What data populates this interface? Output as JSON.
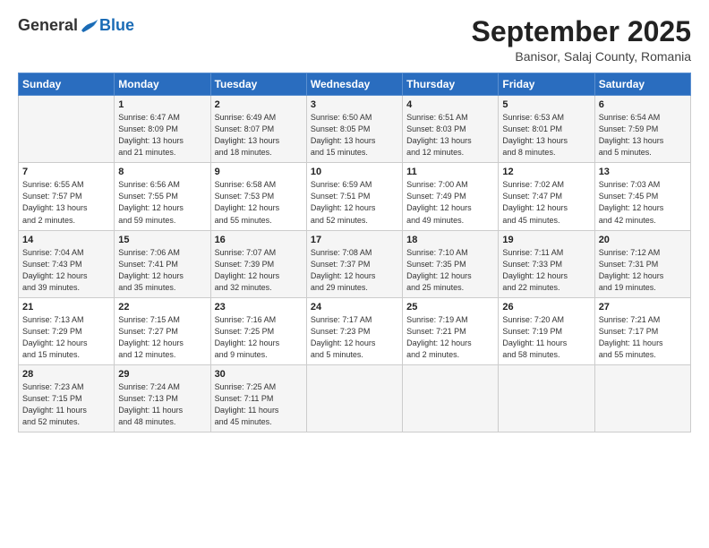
{
  "logo": {
    "general": "General",
    "blue": "Blue"
  },
  "title": "September 2025",
  "subtitle": "Banisor, Salaj County, Romania",
  "days_header": [
    "Sunday",
    "Monday",
    "Tuesday",
    "Wednesday",
    "Thursday",
    "Friday",
    "Saturday"
  ],
  "weeks": [
    [
      {
        "num": "",
        "info": ""
      },
      {
        "num": "1",
        "info": "Sunrise: 6:47 AM\nSunset: 8:09 PM\nDaylight: 13 hours\nand 21 minutes."
      },
      {
        "num": "2",
        "info": "Sunrise: 6:49 AM\nSunset: 8:07 PM\nDaylight: 13 hours\nand 18 minutes."
      },
      {
        "num": "3",
        "info": "Sunrise: 6:50 AM\nSunset: 8:05 PM\nDaylight: 13 hours\nand 15 minutes."
      },
      {
        "num": "4",
        "info": "Sunrise: 6:51 AM\nSunset: 8:03 PM\nDaylight: 13 hours\nand 12 minutes."
      },
      {
        "num": "5",
        "info": "Sunrise: 6:53 AM\nSunset: 8:01 PM\nDaylight: 13 hours\nand 8 minutes."
      },
      {
        "num": "6",
        "info": "Sunrise: 6:54 AM\nSunset: 7:59 PM\nDaylight: 13 hours\nand 5 minutes."
      }
    ],
    [
      {
        "num": "7",
        "info": "Sunrise: 6:55 AM\nSunset: 7:57 PM\nDaylight: 13 hours\nand 2 minutes."
      },
      {
        "num": "8",
        "info": "Sunrise: 6:56 AM\nSunset: 7:55 PM\nDaylight: 12 hours\nand 59 minutes."
      },
      {
        "num": "9",
        "info": "Sunrise: 6:58 AM\nSunset: 7:53 PM\nDaylight: 12 hours\nand 55 minutes."
      },
      {
        "num": "10",
        "info": "Sunrise: 6:59 AM\nSunset: 7:51 PM\nDaylight: 12 hours\nand 52 minutes."
      },
      {
        "num": "11",
        "info": "Sunrise: 7:00 AM\nSunset: 7:49 PM\nDaylight: 12 hours\nand 49 minutes."
      },
      {
        "num": "12",
        "info": "Sunrise: 7:02 AM\nSunset: 7:47 PM\nDaylight: 12 hours\nand 45 minutes."
      },
      {
        "num": "13",
        "info": "Sunrise: 7:03 AM\nSunset: 7:45 PM\nDaylight: 12 hours\nand 42 minutes."
      }
    ],
    [
      {
        "num": "14",
        "info": "Sunrise: 7:04 AM\nSunset: 7:43 PM\nDaylight: 12 hours\nand 39 minutes."
      },
      {
        "num": "15",
        "info": "Sunrise: 7:06 AM\nSunset: 7:41 PM\nDaylight: 12 hours\nand 35 minutes."
      },
      {
        "num": "16",
        "info": "Sunrise: 7:07 AM\nSunset: 7:39 PM\nDaylight: 12 hours\nand 32 minutes."
      },
      {
        "num": "17",
        "info": "Sunrise: 7:08 AM\nSunset: 7:37 PM\nDaylight: 12 hours\nand 29 minutes."
      },
      {
        "num": "18",
        "info": "Sunrise: 7:10 AM\nSunset: 7:35 PM\nDaylight: 12 hours\nand 25 minutes."
      },
      {
        "num": "19",
        "info": "Sunrise: 7:11 AM\nSunset: 7:33 PM\nDaylight: 12 hours\nand 22 minutes."
      },
      {
        "num": "20",
        "info": "Sunrise: 7:12 AM\nSunset: 7:31 PM\nDaylight: 12 hours\nand 19 minutes."
      }
    ],
    [
      {
        "num": "21",
        "info": "Sunrise: 7:13 AM\nSunset: 7:29 PM\nDaylight: 12 hours\nand 15 minutes."
      },
      {
        "num": "22",
        "info": "Sunrise: 7:15 AM\nSunset: 7:27 PM\nDaylight: 12 hours\nand 12 minutes."
      },
      {
        "num": "23",
        "info": "Sunrise: 7:16 AM\nSunset: 7:25 PM\nDaylight: 12 hours\nand 9 minutes."
      },
      {
        "num": "24",
        "info": "Sunrise: 7:17 AM\nSunset: 7:23 PM\nDaylight: 12 hours\nand 5 minutes."
      },
      {
        "num": "25",
        "info": "Sunrise: 7:19 AM\nSunset: 7:21 PM\nDaylight: 12 hours\nand 2 minutes."
      },
      {
        "num": "26",
        "info": "Sunrise: 7:20 AM\nSunset: 7:19 PM\nDaylight: 11 hours\nand 58 minutes."
      },
      {
        "num": "27",
        "info": "Sunrise: 7:21 AM\nSunset: 7:17 PM\nDaylight: 11 hours\nand 55 minutes."
      }
    ],
    [
      {
        "num": "28",
        "info": "Sunrise: 7:23 AM\nSunset: 7:15 PM\nDaylight: 11 hours\nand 52 minutes."
      },
      {
        "num": "29",
        "info": "Sunrise: 7:24 AM\nSunset: 7:13 PM\nDaylight: 11 hours\nand 48 minutes."
      },
      {
        "num": "30",
        "info": "Sunrise: 7:25 AM\nSunset: 7:11 PM\nDaylight: 11 hours\nand 45 minutes."
      },
      {
        "num": "",
        "info": ""
      },
      {
        "num": "",
        "info": ""
      },
      {
        "num": "",
        "info": ""
      },
      {
        "num": "",
        "info": ""
      }
    ]
  ]
}
